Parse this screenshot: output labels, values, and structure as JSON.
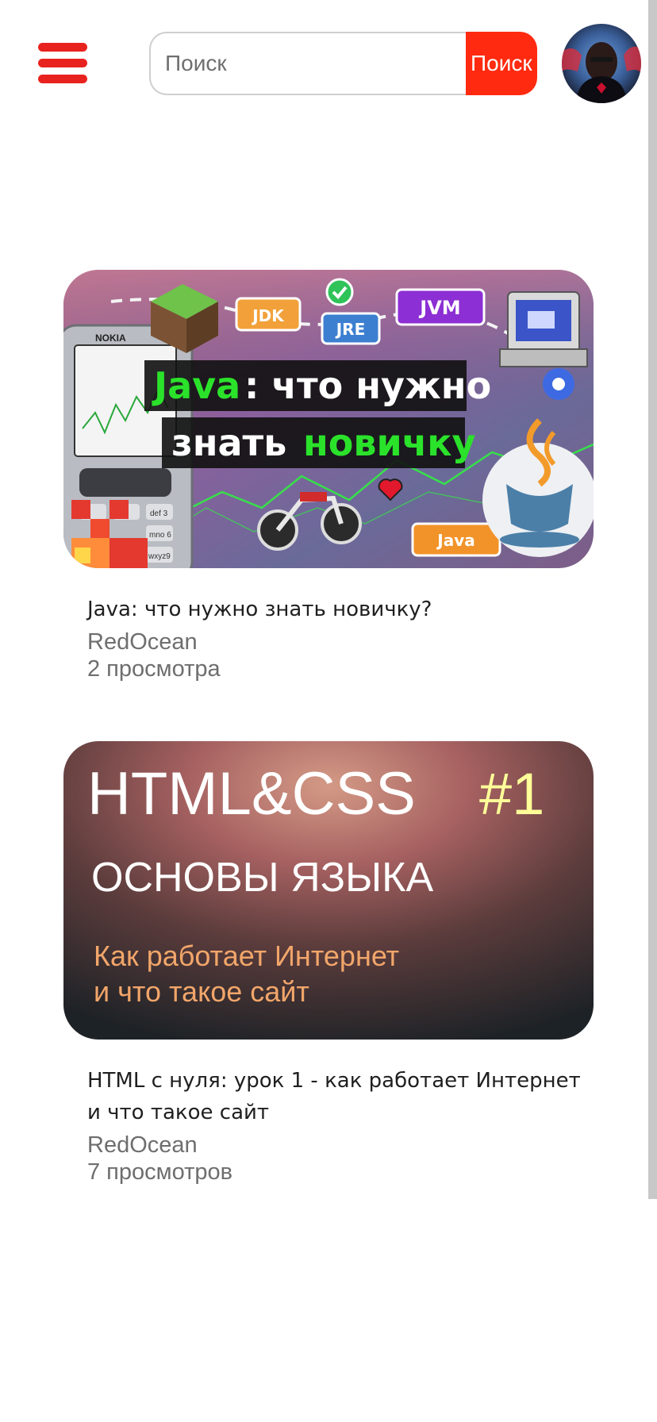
{
  "header": {
    "menu_icon": "hamburger-icon",
    "search": {
      "placeholder": "Поиск",
      "value": "",
      "button_label": "Поиск"
    },
    "avatar_icon": "user-avatar"
  },
  "colors": {
    "accent": "#ff2a0f",
    "menu": "#e8231f"
  },
  "videos": [
    {
      "title": "Java: что нужно знать новичку?",
      "channel": "RedOcean",
      "views": "2 просмотра",
      "thumbnail": {
        "heading_line1_highlight": "Java",
        "heading_line1_rest": ": что нужно",
        "heading_line2_rest": "знать ",
        "heading_line2_highlight": "новичку",
        "tags": [
          "JDK",
          "JRE",
          "JVM",
          "Java"
        ],
        "phone_brand": "NOKIA",
        "keys": [
          "def 3",
          "mno 6",
          "wxyz9"
        ]
      }
    },
    {
      "title": "HTML с нуля: урок 1 - как работает Интернет и что такое сайт",
      "channel": "RedOcean",
      "views": "7 просмотров",
      "thumbnail": {
        "heading": "HTML&CSS",
        "number": "#1",
        "subtitle": "ОСНОВЫ ЯЗЫКА",
        "caption_line1": "Как работает Интернет",
        "caption_line2": "и что такое сайт"
      }
    }
  ]
}
